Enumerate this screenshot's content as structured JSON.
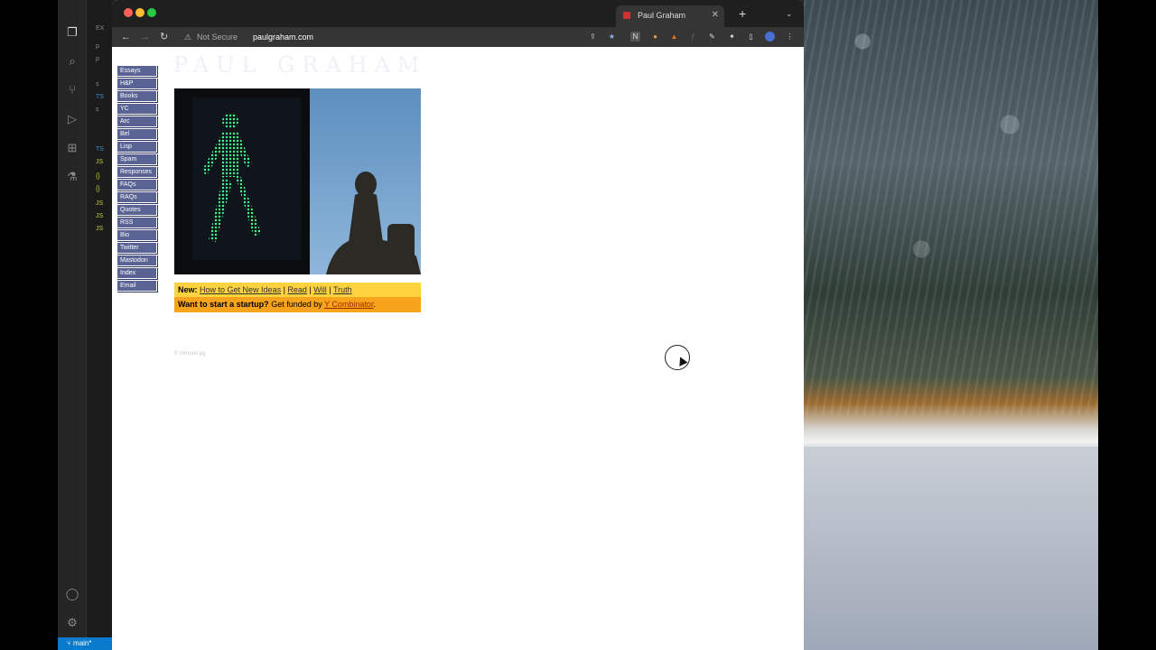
{
  "editor": {
    "explorer_lines": [
      "EX",
      "p",
      "p",
      "s",
      "s",
      "TS",
      "TS",
      "JS",
      "{}",
      "{}",
      "JS",
      "JS",
      "JS"
    ],
    "branch": "main*"
  },
  "browser": {
    "tab_title": "Paul Graham",
    "security_text": "Not Secure",
    "url": "paulgraham.com"
  },
  "site": {
    "logo_text": "PAUL GRAHAM",
    "nav": [
      "Essays",
      "H&P",
      "Books",
      "YC",
      "Arc",
      "Bel",
      "Lisp",
      "Spam",
      "Responses",
      "FAQs",
      "RAQs",
      "Quotes",
      "RSS",
      "Bio",
      "Twitter",
      "Mastodon",
      "Index",
      "Email"
    ],
    "news_label": "New:",
    "news_links": [
      "How to Get New Ideas",
      "Read",
      "Will",
      "Truth"
    ],
    "news_separator": " | ",
    "startup_question": "Want to start a startup?",
    "startup_text": "Get funded by",
    "startup_link": "Y Combinator",
    "startup_end": ".",
    "copyright": "© mmxxiii pg"
  },
  "colors": {
    "nav_bg": "#596394",
    "banner_top": "#ffd23f",
    "banner_bottom": "#f7a31c"
  }
}
